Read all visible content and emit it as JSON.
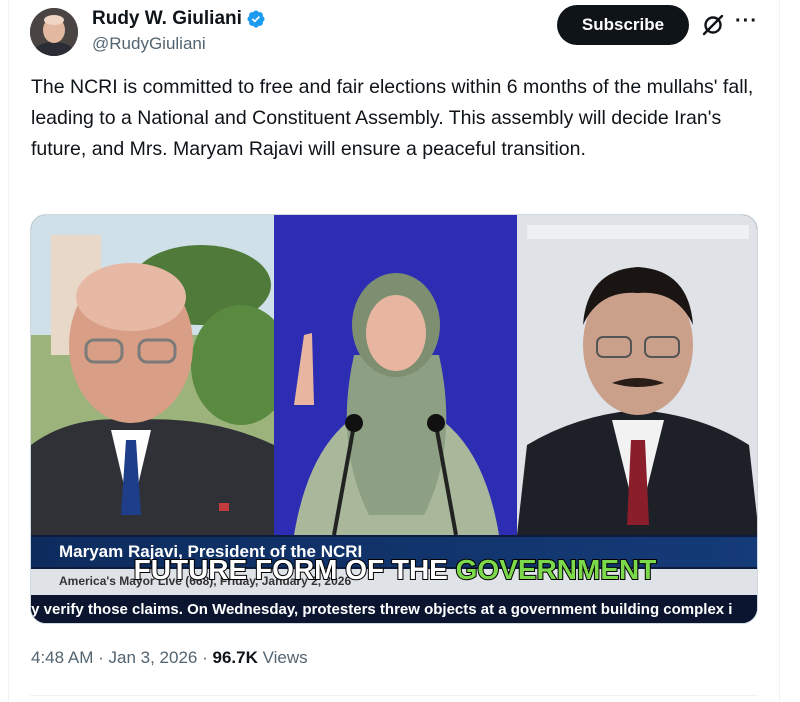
{
  "author": {
    "name": "Rudy W. Giuliani",
    "handle": "@RudyGiuliani",
    "verified_color": "#1d9bf0"
  },
  "actions": {
    "subscribe_label": "Subscribe",
    "grok_icon": "grok-icon",
    "more_icon": "more-icon",
    "more_glyph": "···"
  },
  "tweet": {
    "text": "The NCRI is committed to free and fair elections within 6 months of the mullahs' fall, leading to a National and Constituent Assembly. This assembly will decide Iran's future, and Mrs. Maryam Rajavi will ensure a peaceful transition."
  },
  "media": {
    "caption_name": "Maryam Rajavi, President of the NCRI",
    "dateline": "America's Mayor Live (668), Friday, January 2, 2026",
    "subtitle_white": "FUTURE FORM OF THE",
    "subtitle_green": "GOVERNMENT",
    "ticker": "ly verify those claims. On Wednesday, protesters threw objects at a government building complex i"
  },
  "meta": {
    "time": "4:48 AM",
    "sep1": "·",
    "date": "Jan 3, 2026",
    "sep2": "·",
    "views_count": "96.7K",
    "views_label": "Views"
  }
}
